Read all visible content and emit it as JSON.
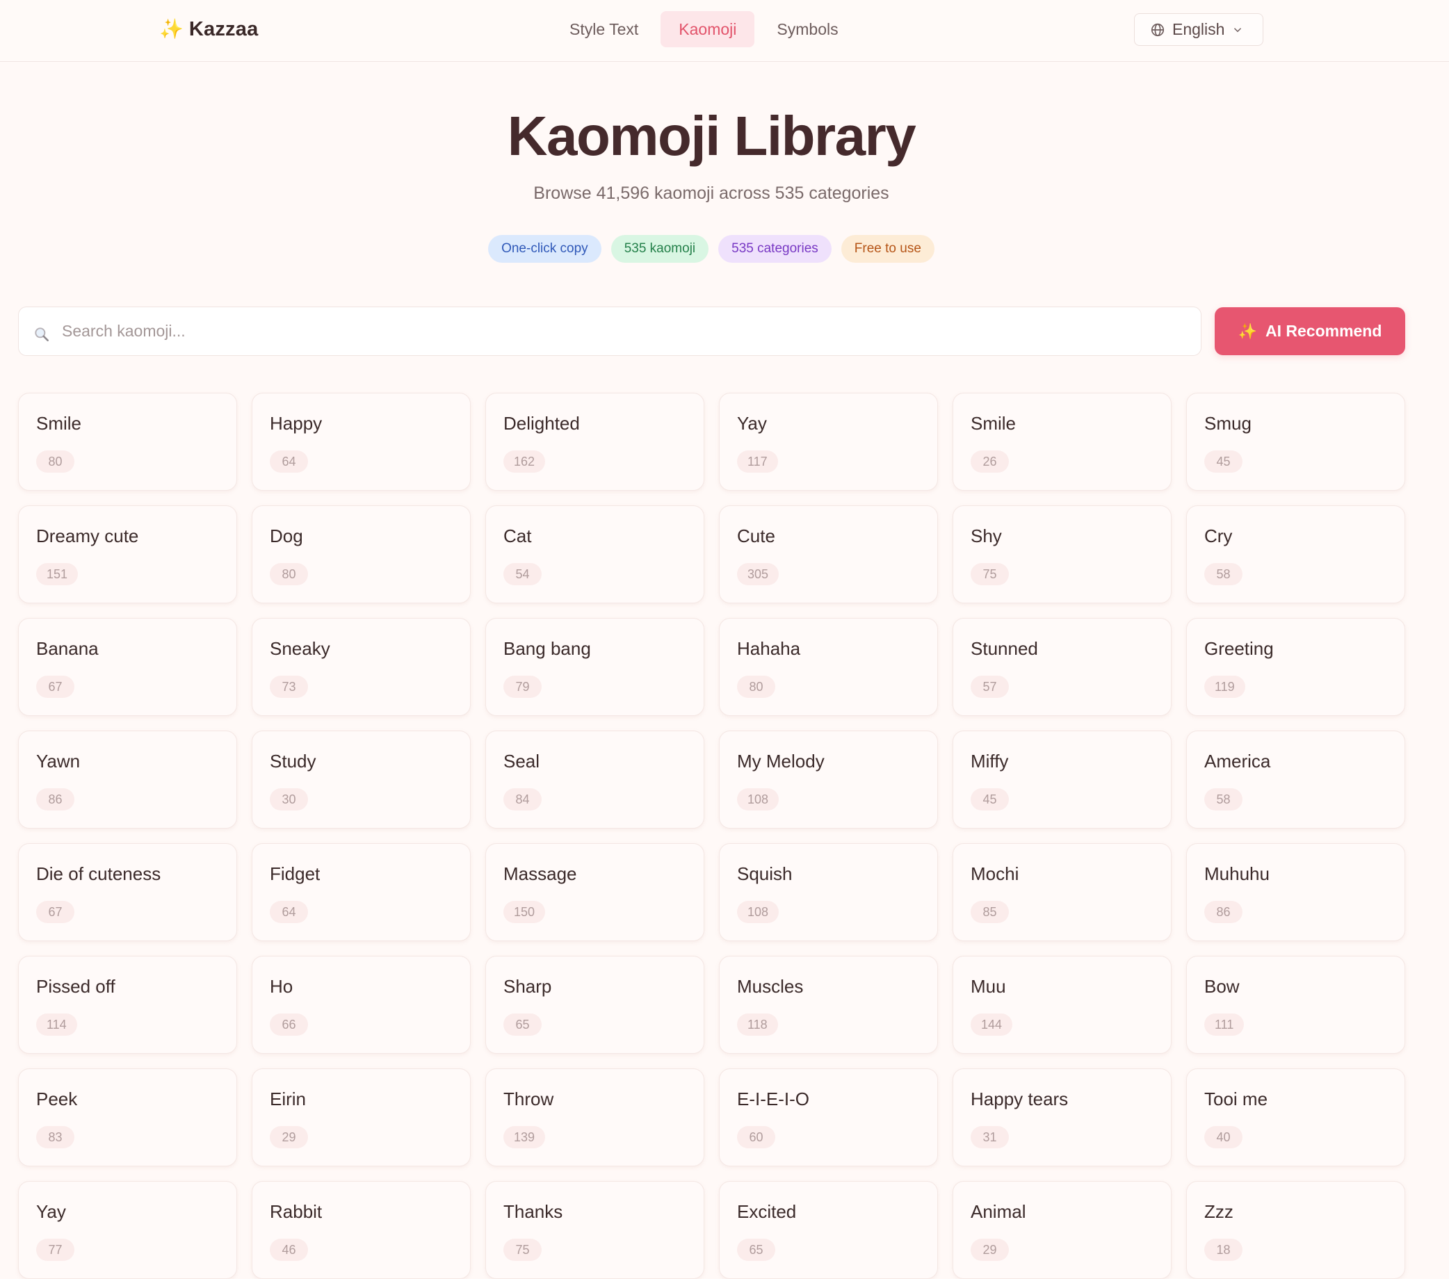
{
  "header": {
    "logo_icon": "sparkles-icon",
    "logo_text": "Kazzaa",
    "nav": [
      {
        "label": "Style Text"
      },
      {
        "label": "Kaomoji",
        "active": true
      },
      {
        "label": "Symbols"
      }
    ],
    "language": "English"
  },
  "hero": {
    "title": "Kaomoji Library",
    "subtitle": "Browse 41,596 kaomoji across 535 categories",
    "pills": [
      "One-click copy",
      "535 kaomoji",
      "535 categories",
      "Free to use"
    ]
  },
  "search": {
    "placeholder": "Search kaomoji...",
    "value": ""
  },
  "ai_button": {
    "label": "AI Recommend"
  },
  "colors": {
    "accent": "#e75670",
    "background": "#fff9f7",
    "title": "#452a2c"
  },
  "categories": [
    {
      "name": "Smile",
      "count": "80"
    },
    {
      "name": "Happy",
      "count": "64"
    },
    {
      "name": "Delighted",
      "count": "162"
    },
    {
      "name": "Yay",
      "count": "117"
    },
    {
      "name": "Smile",
      "count": "26"
    },
    {
      "name": "Smug",
      "count": "45"
    },
    {
      "name": "Dreamy cute",
      "count": "151"
    },
    {
      "name": "Dog",
      "count": "80"
    },
    {
      "name": "Cat",
      "count": "54"
    },
    {
      "name": "Cute",
      "count": "305"
    },
    {
      "name": "Shy",
      "count": "75"
    },
    {
      "name": "Cry",
      "count": "58"
    },
    {
      "name": "Banana",
      "count": "67"
    },
    {
      "name": "Sneaky",
      "count": "73"
    },
    {
      "name": "Bang bang",
      "count": "79"
    },
    {
      "name": "Hahaha",
      "count": "80"
    },
    {
      "name": "Stunned",
      "count": "57"
    },
    {
      "name": "Greeting",
      "count": "119"
    },
    {
      "name": "Yawn",
      "count": "86"
    },
    {
      "name": "Study",
      "count": "30"
    },
    {
      "name": "Seal",
      "count": "84"
    },
    {
      "name": "My Melody",
      "count": "108"
    },
    {
      "name": "Miffy",
      "count": "45"
    },
    {
      "name": "America",
      "count": "58"
    },
    {
      "name": "Die of cuteness",
      "count": "67"
    },
    {
      "name": "Fidget",
      "count": "64"
    },
    {
      "name": "Massage",
      "count": "150"
    },
    {
      "name": "Squish",
      "count": "108"
    },
    {
      "name": "Mochi",
      "count": "85"
    },
    {
      "name": "Muhuhu",
      "count": "86"
    },
    {
      "name": "Pissed off",
      "count": "114"
    },
    {
      "name": "Ho",
      "count": "66"
    },
    {
      "name": "Sharp",
      "count": "65"
    },
    {
      "name": "Muscles",
      "count": "118"
    },
    {
      "name": "Muu",
      "count": "144"
    },
    {
      "name": "Bow",
      "count": "111"
    },
    {
      "name": "Peek",
      "count": "83"
    },
    {
      "name": "Eirin",
      "count": "29"
    },
    {
      "name": "Throw",
      "count": "139"
    },
    {
      "name": "E-I-E-I-O",
      "count": "60"
    },
    {
      "name": "Happy tears",
      "count": "31"
    },
    {
      "name": "Tooi me",
      "count": "40"
    },
    {
      "name": "Yay",
      "count": "77"
    },
    {
      "name": "Rabbit",
      "count": "46"
    },
    {
      "name": "Thanks",
      "count": "75"
    },
    {
      "name": "Excited",
      "count": "65"
    },
    {
      "name": "Animal",
      "count": "29"
    },
    {
      "name": "Zzz",
      "count": "18"
    }
  ]
}
